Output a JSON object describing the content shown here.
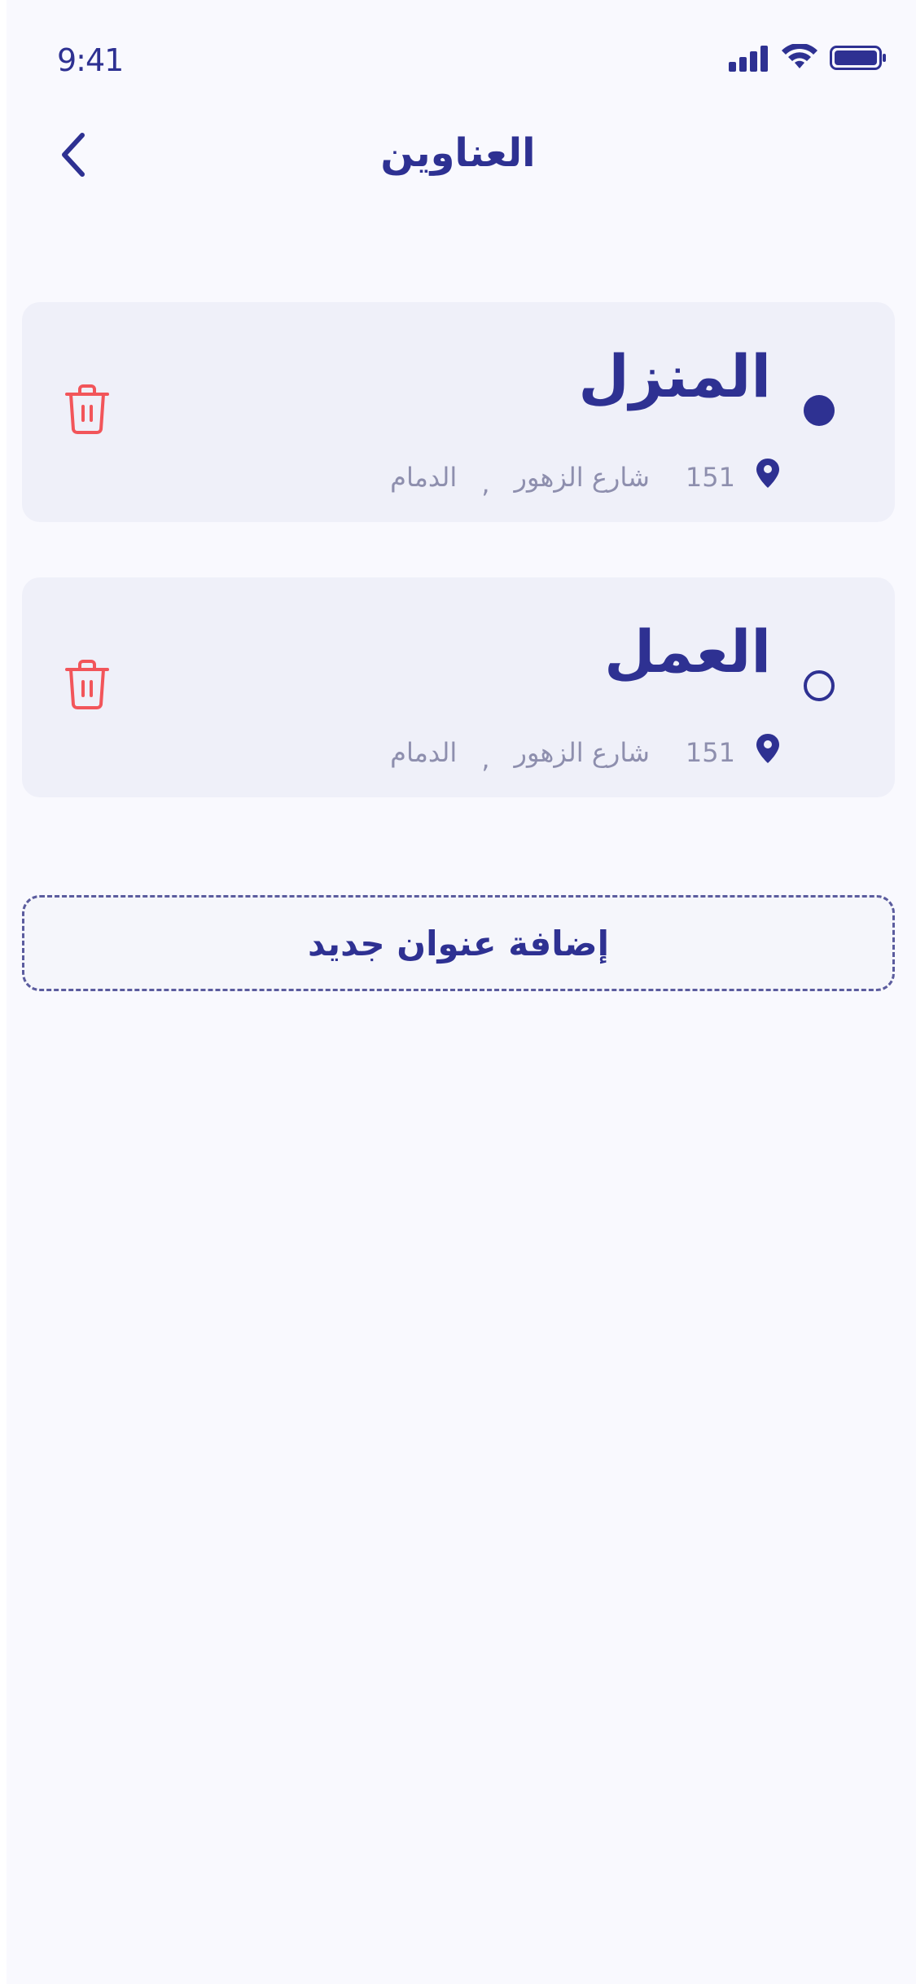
{
  "status_bar": {
    "time": "9:41"
  },
  "header": {
    "title": "العناوين",
    "back_icon": "chevron-left-icon"
  },
  "addresses": [
    {
      "name": "المنزل",
      "selected": true,
      "number": "151",
      "street": "شارع الزهور",
      "separator": ",",
      "city": "الدمام"
    },
    {
      "name": "العمل",
      "selected": false,
      "number": "151",
      "street": "شارع الزهور",
      "separator": ",",
      "city": "الدمام"
    }
  ],
  "add_button": {
    "label": "إضافة عنوان جديد"
  },
  "colors": {
    "primary": "#2E3192",
    "delete": "#F2555A",
    "card_bg": "#EFF0F9",
    "muted_text": "#8E8FAE",
    "page_bg": "#F9F9FE"
  }
}
